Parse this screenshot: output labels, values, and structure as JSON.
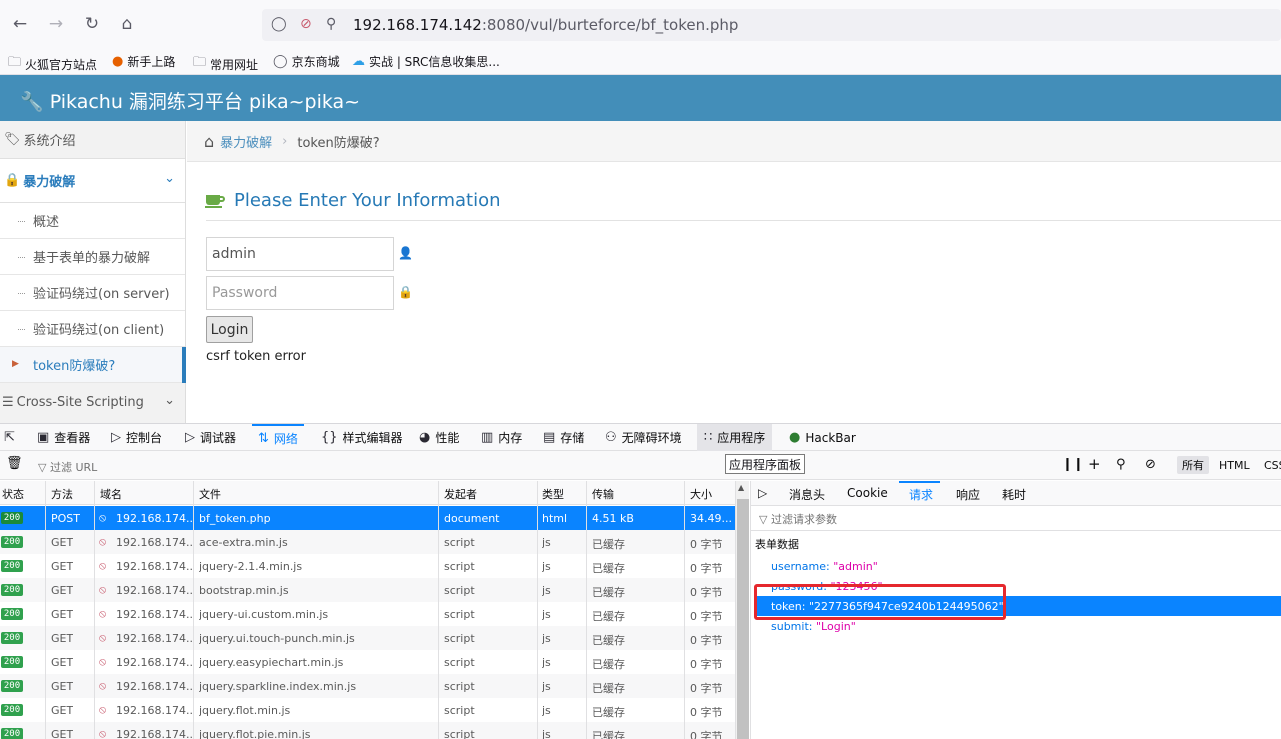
{
  "browser": {
    "url_host": "192.168.174.142",
    "url_rest": ":8080/vul/burteforce/bf_token.php",
    "bookmarks": [
      "火狐官方站点",
      "新手上路",
      "常用网址",
      "京东商城",
      "实战 | SRC信息收集思..."
    ]
  },
  "app": {
    "title": "Pikachu 漏洞练习平台 pika~pika~"
  },
  "sidebar": {
    "intro": "系统介绍",
    "section": "暴力破解",
    "items": [
      "概述",
      "基于表单的暴力破解",
      "验证码绕过(on server)",
      "验证码绕过(on client)",
      "token防爆破?"
    ],
    "xss": "Cross-Site Scripting"
  },
  "breadcrumb": {
    "link": "暴力破解",
    "current": "token防爆破?"
  },
  "form": {
    "title": "Please Enter Your Information",
    "username_value": "admin",
    "password_placeholder": "Password",
    "login_label": "Login",
    "message": "csrf token error"
  },
  "devtools": {
    "tabs": [
      "查看器",
      "控制台",
      "调试器",
      "网络",
      "样式编辑器",
      "性能",
      "内存",
      "存储",
      "无障碍环境",
      "应用程序",
      "HackBar"
    ],
    "tooltip": "应用程序面板",
    "filter_placeholder": "过滤 URL",
    "type_filters": [
      "所有",
      "HTML",
      "CSS"
    ],
    "columns": [
      "状态",
      "方法",
      "域名",
      "文件",
      "发起者",
      "类型",
      "传输",
      "大小"
    ],
    "rows": [
      {
        "status": "200",
        "method": "POST",
        "domain": "192.168.174...",
        "file": "bf_token.php",
        "initiator": "document",
        "type": "html",
        "transfer": "4.51 kB",
        "size": "34.49..."
      },
      {
        "status": "200",
        "method": "GET",
        "domain": "192.168.174...",
        "file": "ace-extra.min.js",
        "initiator": "script",
        "type": "js",
        "transfer": "已缓存",
        "size": "0 字节"
      },
      {
        "status": "200",
        "method": "GET",
        "domain": "192.168.174...",
        "file": "jquery-2.1.4.min.js",
        "initiator": "script",
        "type": "js",
        "transfer": "已缓存",
        "size": "0 字节"
      },
      {
        "status": "200",
        "method": "GET",
        "domain": "192.168.174...",
        "file": "bootstrap.min.js",
        "initiator": "script",
        "type": "js",
        "transfer": "已缓存",
        "size": "0 字节"
      },
      {
        "status": "200",
        "method": "GET",
        "domain": "192.168.174...",
        "file": "jquery-ui.custom.min.js",
        "initiator": "script",
        "type": "js",
        "transfer": "已缓存",
        "size": "0 字节"
      },
      {
        "status": "200",
        "method": "GET",
        "domain": "192.168.174...",
        "file": "jquery.ui.touch-punch.min.js",
        "initiator": "script",
        "type": "js",
        "transfer": "已缓存",
        "size": "0 字节"
      },
      {
        "status": "200",
        "method": "GET",
        "domain": "192.168.174...",
        "file": "jquery.easypiechart.min.js",
        "initiator": "script",
        "type": "js",
        "transfer": "已缓存",
        "size": "0 字节"
      },
      {
        "status": "200",
        "method": "GET",
        "domain": "192.168.174...",
        "file": "jquery.sparkline.index.min.js",
        "initiator": "script",
        "type": "js",
        "transfer": "已缓存",
        "size": "0 字节"
      },
      {
        "status": "200",
        "method": "GET",
        "domain": "192.168.174...",
        "file": "jquery.flot.min.js",
        "initiator": "script",
        "type": "js",
        "transfer": "已缓存",
        "size": "0 字节"
      },
      {
        "status": "200",
        "method": "GET",
        "domain": "192.168.174...",
        "file": "jquery.flot.pie.min.js",
        "initiator": "script",
        "type": "js",
        "transfer": "已缓存",
        "size": "0 字节"
      }
    ],
    "detail_tabs": [
      "消息头",
      "Cookie",
      "请求",
      "响应",
      "耗时"
    ],
    "detail_filter": "过滤请求参数",
    "form_data_title": "表单数据",
    "params": [
      {
        "key": "username",
        "value": "\"admin\""
      },
      {
        "key": "password",
        "value": "\"123456\""
      },
      {
        "key": "token",
        "value": "\"2277365f947ce9240b124495062\""
      },
      {
        "key": "submit",
        "value": "\"Login\""
      }
    ]
  },
  "colors": {
    "header": "#438eb9",
    "accent": "#0a84ff",
    "highlight_box": "#e5282d",
    "status_ok": "#30a14e"
  }
}
